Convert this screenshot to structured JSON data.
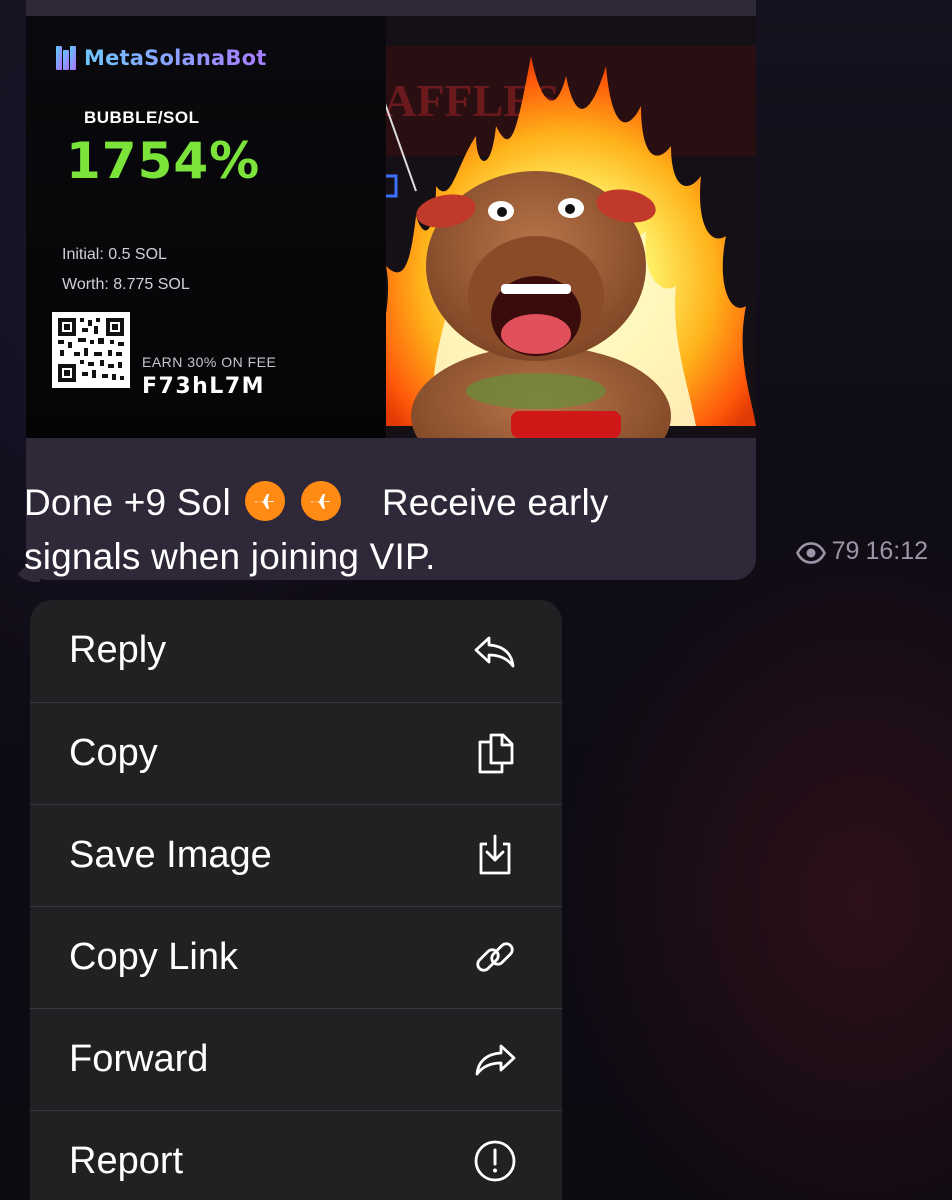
{
  "message": {
    "card": {
      "brand": "MetaSolanaBot",
      "pair": "BUBBLE/SOL",
      "percent": "1754%",
      "initial": "Initial: 0.5 SOL",
      "worth": "Worth: 8.775 SOL",
      "earn_label": "EARN 30% ON FEE",
      "referral_code": "F73hL7M"
    },
    "caption_line1_before": "Done +9 Sol",
    "caption_line1_after": "Receive early",
    "caption_line2": "signals when joining VIP.",
    "badges": [
      "airplane-icon",
      "airplane-icon"
    ],
    "views": "79",
    "time": "16:12"
  },
  "menu": {
    "items": [
      {
        "label": "Reply",
        "icon": "reply-icon"
      },
      {
        "label": "Copy",
        "icon": "copy-icon"
      },
      {
        "label": "Save Image",
        "icon": "save-image-icon"
      },
      {
        "label": "Copy Link",
        "icon": "link-icon"
      },
      {
        "label": "Forward",
        "icon": "forward-icon"
      },
      {
        "label": "Report",
        "icon": "report-icon"
      }
    ]
  },
  "colors": {
    "bubble": "#2e2838",
    "menu": "#212123",
    "percent": "#7be33a",
    "badge": "#ff8a14",
    "meta": "#9b95a8"
  }
}
